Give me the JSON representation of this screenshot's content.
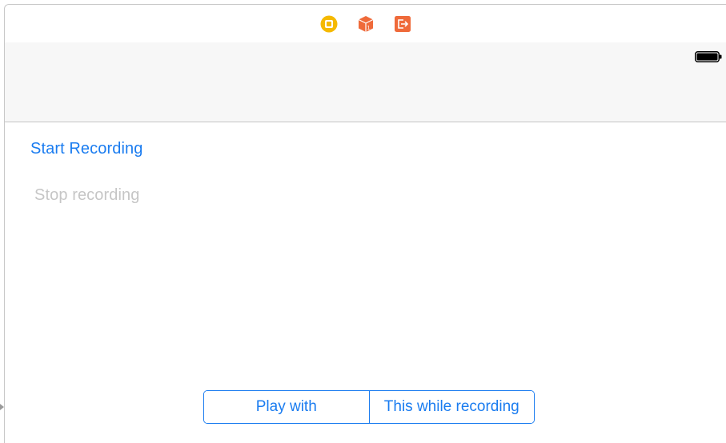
{
  "scene_dock": {
    "icons": [
      {
        "name": "view-controller-icon",
        "color": "#f5b900"
      },
      {
        "name": "first-responder-icon",
        "color": "#ef6a3a"
      },
      {
        "name": "exit-icon",
        "color": "#ef6a3a"
      }
    ]
  },
  "status_bar": {
    "battery_icon": "battery-icon"
  },
  "main": {
    "start_recording_label": "Start Recording",
    "stop_recording_label": "Stop recording",
    "segmented_control": {
      "segments": [
        {
          "label": "Play with"
        },
        {
          "label": "This while recording"
        }
      ]
    }
  },
  "colors": {
    "tint": "#1a7cf0",
    "disabled_text": "#c6c6c6",
    "nav_bar_bg": "#f7f7f7"
  }
}
